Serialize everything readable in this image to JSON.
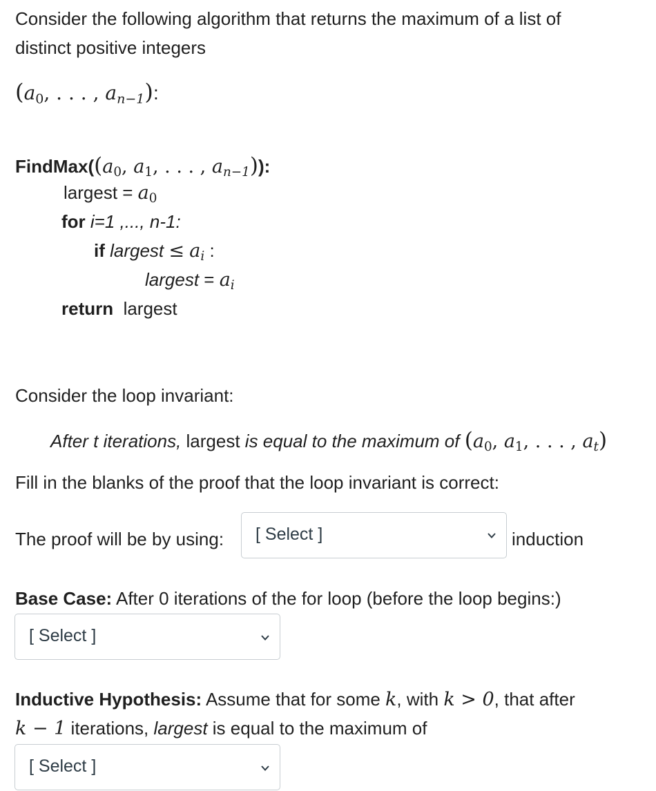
{
  "intro": {
    "line1": "Consider the following algorithm that returns the maximum of a list of",
    "line2": "distinct positive integers",
    "tuple": {
      "open": "(",
      "a": "a",
      "s0": "0",
      "sep": ", . . . , ",
      "sn": "n−1",
      "close": ")",
      "tail": ":"
    }
  },
  "algorithm": {
    "name": "FindMax(",
    "sig_tail": "):",
    "sig_tuple": {
      "open": "(",
      "a": "a",
      "s0": "0",
      "sep1": ", ",
      "s1": "1",
      "sep2": ", . . . , ",
      "sn": "n−1",
      "close": ")"
    },
    "line_largest": "largest = ",
    "line_largest_sub": "0",
    "for_kw": "for",
    "for_rest": " i=1 ,..., n-1:",
    "if_kw": "if",
    "if_var": " largest ",
    "if_op": "≤",
    "if_sub": "i",
    "if_tail": " :",
    "assign_var": "largest",
    "assign_eq": " = ",
    "assign_sub": "i",
    "return_kw": "return",
    "return_val": "  largest"
  },
  "invariant": {
    "intro": "Consider the loop invariant:",
    "part1": "After t iterations, ",
    "part2": "largest",
    "part3": " is equal to the maximum of ",
    "tuple": {
      "open": "(",
      "a": "a",
      "s0": "0",
      "sep1": ", ",
      "s1": "1",
      "sep2": ", . . . , ",
      "st": "t",
      "close": ")"
    }
  },
  "instructions": "Fill in the blanks of the proof that the loop invariant is correct:",
  "proof_type": {
    "label": "The proof will be by using:",
    "select_value": "[ Select ]",
    "suffix": "induction"
  },
  "base_case": {
    "label": "Base Case:",
    "text": " After 0 iterations of the for loop (before the loop begins:)",
    "select_value": "[ Select ]"
  },
  "inductive_hypothesis": {
    "label": "Inductive Hypothesis:",
    "text1": " Assume that for some ",
    "k": "k",
    "text2": ", with ",
    "cond": "k > 0",
    "text3": ", that after",
    "km1": "k − 1",
    "text4": " iterations, ",
    "largest": "largest",
    "text5": " is equal to the maximum of",
    "select_value": "[ Select ]"
  },
  "icons": {
    "dropdown": "chevron-down-icon"
  }
}
